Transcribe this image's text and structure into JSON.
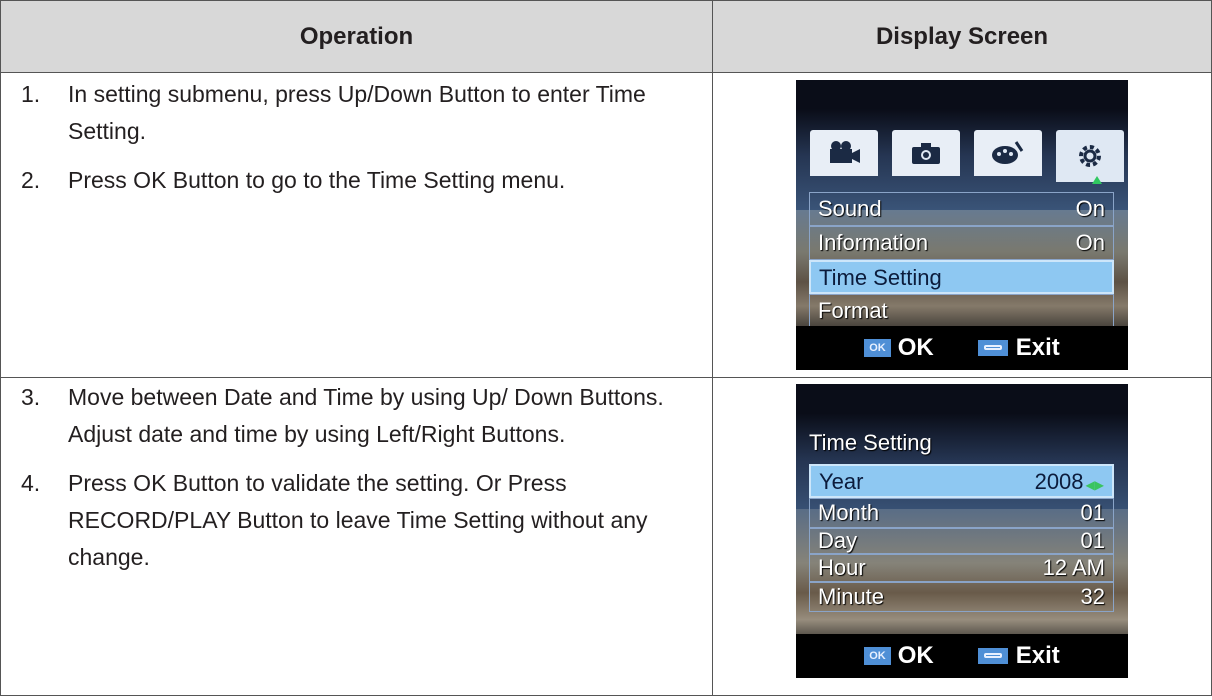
{
  "headers": {
    "operation": "Operation",
    "display": "Display Screen"
  },
  "rows": [
    {
      "steps": [
        {
          "num": "1.",
          "text": "In setting submenu, press Up/Down Button to enter Time Setting."
        },
        {
          "num": "2.",
          "text": "Press OK Button to go to the Time Setting menu."
        }
      ],
      "screen": {
        "tab_icons": [
          "movie-mode-icon",
          "camera-icon",
          "effect-palette-icon",
          "settings-gear-icon"
        ],
        "items": [
          {
            "label": "Sound",
            "value": "On"
          },
          {
            "label": "Information",
            "value": "On"
          },
          {
            "label": "Time Setting",
            "value": ""
          },
          {
            "label": "Format",
            "value": ""
          }
        ],
        "selected_index": 2,
        "footer": {
          "ok_badge": "OK",
          "ok_label": "OK",
          "exit_label": "Exit"
        }
      }
    },
    {
      "steps": [
        {
          "num": "3.",
          "text": "Move between Date and Time by using Up/ Down Buttons. Adjust date and time by using Left/Right Buttons."
        },
        {
          "num": "4.",
          "text": "Press OK Button to validate the setting. Or Press RECORD/PLAY Button to leave Time Setting without any change."
        }
      ],
      "screen": {
        "title": "Time Setting",
        "items": [
          {
            "label": "Year",
            "value": "2008"
          },
          {
            "label": "Month",
            "value": "01"
          },
          {
            "label": "Day",
            "value": "01"
          },
          {
            "label": "Hour",
            "value": "12 AM"
          },
          {
            "label": "Minute",
            "value": "32"
          }
        ],
        "selected_index": 0,
        "footer": {
          "ok_badge": "OK",
          "ok_label": "OK",
          "exit_label": "Exit"
        }
      }
    }
  ],
  "colors": {
    "header_bg": "#d8d8d8",
    "highlight": "#8ec8f2",
    "icon_blue": "#4f8fd6"
  }
}
